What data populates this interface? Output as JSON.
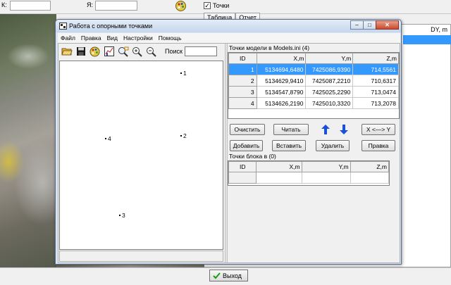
{
  "background": {
    "field_k_label": "К:",
    "field_y_label": "Я:",
    "checkbox_points_label": "Точки",
    "checkbox_checked_mark": "✓",
    "tabs": [
      "Таблица",
      "Отчет"
    ],
    "column_dy": "DY, m",
    "exit_label": "Выход"
  },
  "window": {
    "title": "Работа с опорными точками",
    "minimize_glyph": "–",
    "maximize_glyph": "□",
    "close_glyph": "✕"
  },
  "menu": [
    "Файл",
    "Правка",
    "Вид",
    "Настройки",
    "Помощь"
  ],
  "toolbar": {
    "icons": [
      "open-folder-icon",
      "save-icon",
      "palette-icon",
      "chart-icon",
      "zoom-region-icon",
      "zoom-in-icon",
      "zoom-out-icon"
    ],
    "search_label": "Поиск",
    "search_value": ""
  },
  "plot_points": [
    {
      "label": "1"
    },
    {
      "label": "2"
    },
    {
      "label": "3"
    },
    {
      "label": "4"
    }
  ],
  "model_points": {
    "title": "Точки модели в Models.ini (4)",
    "columns": [
      "ID",
      "X,m",
      "Y,m",
      "Z,m"
    ],
    "rows": [
      {
        "id": "1",
        "x": "5134694,6480",
        "y": "7425086,9390",
        "z": "714,5561",
        "selected": true
      },
      {
        "id": "2",
        "x": "5134629,9410",
        "y": "7425087,2210",
        "z": "710,6317",
        "selected": false
      },
      {
        "id": "3",
        "x": "5134547,8790",
        "y": "7425025,2290",
        "z": "713,0474",
        "selected": false
      },
      {
        "id": "4",
        "x": "5134626,2190",
        "y": "7425010,3320",
        "z": "713,2078",
        "selected": false
      }
    ]
  },
  "buttons": {
    "clear": "Очистить",
    "read": "Читать",
    "swap_xy": "X <—> Y",
    "add": "Добавить",
    "insert": "Вставить",
    "delete": "Удалить",
    "edit": "Правка"
  },
  "block_points": {
    "title": "Точки блока в  (0)",
    "columns": [
      "ID",
      "X,m",
      "Y,m",
      "Z,m"
    ]
  },
  "colors": {
    "selection": "#3399ff",
    "arrow_blue": "#1a4fd8"
  }
}
